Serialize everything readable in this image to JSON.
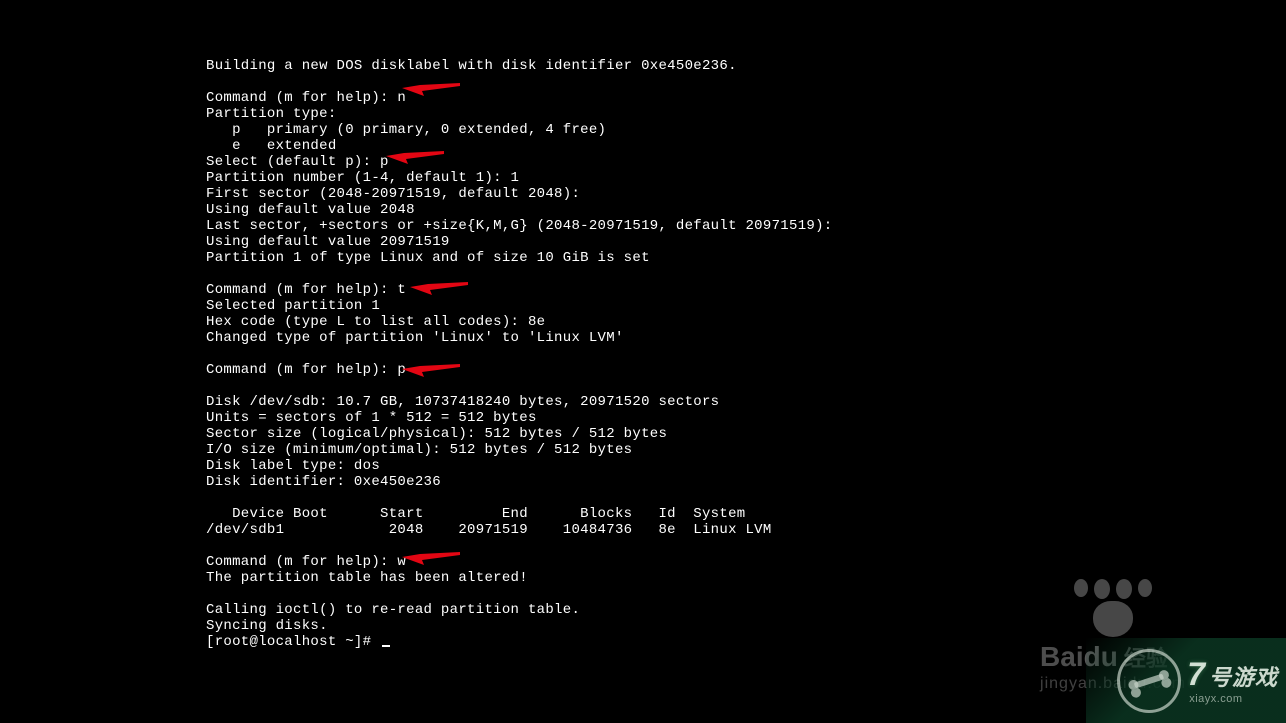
{
  "terminal": {
    "lines": [
      "Building a new DOS disklabel with disk identifier 0xe450e236.",
      "",
      "Command (m for help): n",
      "Partition type:",
      "   p   primary (0 primary, 0 extended, 4 free)",
      "   e   extended",
      "Select (default p): p",
      "Partition number (1-4, default 1): 1",
      "First sector (2048-20971519, default 2048):",
      "Using default value 2048",
      "Last sector, +sectors or +size{K,M,G} (2048-20971519, default 20971519):",
      "Using default value 20971519",
      "Partition 1 of type Linux and of size 10 GiB is set",
      "",
      "Command (m for help): t",
      "Selected partition 1",
      "Hex code (type L to list all codes): 8e",
      "Changed type of partition 'Linux' to 'Linux LVM'",
      "",
      "Command (m for help): p",
      "",
      "Disk /dev/sdb: 10.7 GB, 10737418240 bytes, 20971520 sectors",
      "Units = sectors of 1 * 512 = 512 bytes",
      "Sector size (logical/physical): 512 bytes / 512 bytes",
      "I/O size (minimum/optimal): 512 bytes / 512 bytes",
      "Disk label type: dos",
      "Disk identifier: 0xe450e236",
      "",
      "   Device Boot      Start         End      Blocks   Id  System",
      "/dev/sdb1            2048    20971519    10484736   8e  Linux LVM",
      "",
      "Command (m for help): w",
      "The partition table has been altered!",
      "",
      "Calling ioctl() to re-read partition table.",
      "Syncing disks.",
      "[root@localhost ~]# "
    ]
  },
  "annotations": {
    "arrow_count": 5
  },
  "watermarks": {
    "baidu": {
      "brand": "Bai",
      "brand2": "du",
      "cn": "经验",
      "url": "jingyan.baidu.com"
    },
    "corner": {
      "seven": "7",
      "big": "号游戏",
      "domain": "xiayx.com"
    }
  }
}
